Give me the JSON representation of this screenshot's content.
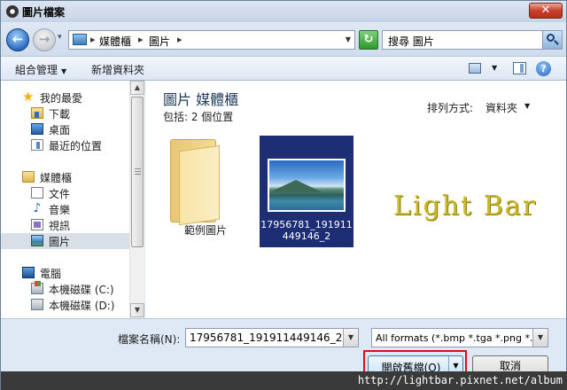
{
  "window": {
    "title": "圖片檔案",
    "close": "✕"
  },
  "navbar": {
    "back": "←",
    "forward": "→",
    "breadcrumb": [
      "媒體櫃",
      "圖片"
    ],
    "search_placeholder": "搜尋 圖片",
    "refresh": "↻"
  },
  "commandbar": {
    "organize": "組合管理",
    "new_folder": "新增資料夾",
    "help": "?"
  },
  "sidebar": {
    "favorites": {
      "label": "我的最愛",
      "items": [
        "下載",
        "桌面",
        "最近的位置"
      ]
    },
    "libraries": {
      "label": "媒體櫃",
      "items": [
        "文件",
        "音樂",
        "視訊",
        "圖片"
      ],
      "selected": "圖片"
    },
    "computer": {
      "label": "電腦",
      "items": [
        "本機磁碟 (C:)",
        "本機磁碟 (D:)"
      ]
    }
  },
  "content": {
    "title": "圖片 媒體櫃",
    "subtitle": "包括:  2 個位置",
    "sort_label": "排列方式:",
    "sort_value": "資料夾",
    "items": [
      {
        "name": "範例圖片",
        "type": "folder"
      },
      {
        "name_line1": "17956781_191911",
        "name_line2": "449146_2",
        "type": "image",
        "selected": true
      }
    ],
    "watermark": "Light Bar"
  },
  "footer": {
    "filename_label": "檔案名稱(N):",
    "filename_value": "17956781_191911449146_2",
    "filetype_value": "All formats (*.bmp *.tga *.png *.gif",
    "open_label": "開啟舊檔(O)",
    "cancel_label": "取消",
    "url": "http://lightbar.pixnet.net/album"
  },
  "colors": {
    "accent": "#1d2e74",
    "highlight_outline": "#e01010",
    "watermark": "#c9b82a"
  }
}
